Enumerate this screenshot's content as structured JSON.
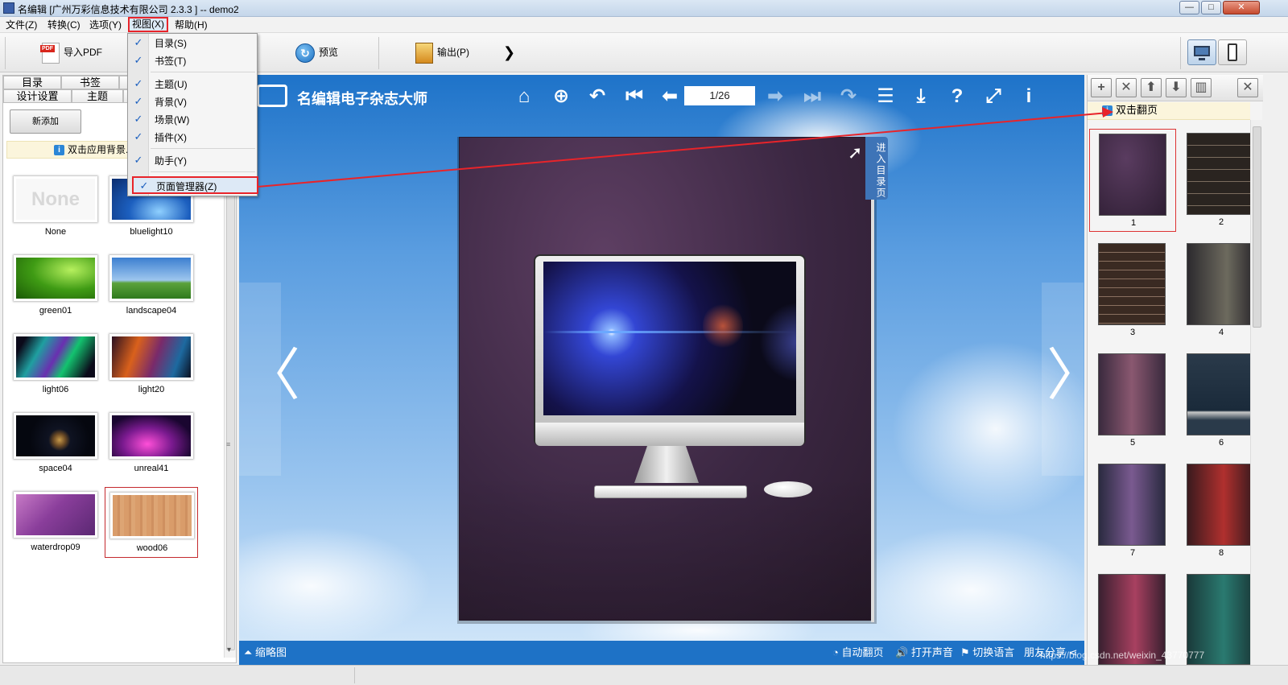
{
  "window": {
    "title": "名编辑 [广州万彩信息技术有限公司 2.3.3 ] -- demo2",
    "controls": {
      "minimize": "—",
      "maximize": "□",
      "close": "✕"
    }
  },
  "menubar": {
    "items": [
      "文件(Z)",
      "转换(C)",
      "选项(Y)",
      "视图(X)",
      "帮助(H)"
    ]
  },
  "toolbar": {
    "import_label": "导入PDF",
    "import_badge": "PDF",
    "preview_label": "预览",
    "preview_glyph": "↻",
    "output_label": "输出(P)",
    "more_glyph": "❯"
  },
  "view_menu": {
    "items": [
      {
        "label": "目录(S)",
        "checked": true
      },
      {
        "label": "书签(T)",
        "checked": true
      },
      {
        "label": "主题(U)",
        "checked": true
      },
      {
        "label": "背景(V)",
        "checked": true
      },
      {
        "label": "场景(W)",
        "checked": true
      },
      {
        "label": "插件(X)",
        "checked": true
      },
      {
        "label": "助手(Y)",
        "checked": true
      },
      {
        "label": "页面管理器(Z)",
        "checked": true
      }
    ],
    "check_glyph": "✓"
  },
  "left_panel": {
    "tabs_row1": [
      "目录",
      "书签",
      ""
    ],
    "tabs_row2": [
      "设计设置",
      "主题",
      ""
    ],
    "add_button": "新添加",
    "hint": "双击应用背景.",
    "info_glyph": "i",
    "backgrounds": [
      {
        "name": "None",
        "preview_text": "None"
      },
      {
        "name": "bluelight10"
      },
      {
        "name": "green01"
      },
      {
        "name": "landscape04"
      },
      {
        "name": "light06"
      },
      {
        "name": "light20"
      },
      {
        "name": "space04"
      },
      {
        "name": "unreal41"
      },
      {
        "name": "waterdrop09"
      },
      {
        "name": "wood06",
        "selected": true
      }
    ],
    "scroll_grip": "≡",
    "scroll_down": "▾"
  },
  "viewer": {
    "logo_text": "名编辑电子杂志大师",
    "icons": [
      {
        "name": "home-icon",
        "glyph": "⌂",
        "enabled": true
      },
      {
        "name": "zoom-in-icon",
        "glyph": "⊕",
        "enabled": true
      },
      {
        "name": "back-icon",
        "glyph": "↶",
        "enabled": true
      },
      {
        "name": "first-page-icon",
        "glyph": "⏮",
        "enabled": true
      },
      {
        "name": "prev-page-icon",
        "glyph": "⬅",
        "enabled": true
      },
      {
        "name": "next-page-icon",
        "glyph": "➡",
        "enabled": false
      },
      {
        "name": "last-page-icon",
        "glyph": "⏭",
        "enabled": false
      },
      {
        "name": "forward-icon",
        "glyph": "↷",
        "enabled": false
      },
      {
        "name": "toc-list-icon",
        "glyph": "☰",
        "enabled": true
      },
      {
        "name": "download-icon",
        "glyph": "⤓",
        "enabled": true
      },
      {
        "name": "help-icon",
        "glyph": "?",
        "enabled": true
      },
      {
        "name": "fullscreen-icon",
        "glyph": "⤢",
        "enabled": true
      },
      {
        "name": "info-icon",
        "glyph": "i",
        "enabled": true
      }
    ],
    "page_indicator": "1/26",
    "toc_tab": "进入目录页",
    "prev_glyph": "〈",
    "next_glyph": "〉",
    "corner_glyph": "➚",
    "bottom": {
      "thumbnail": "缩略图",
      "autoflip": "自动翻页",
      "sound": "打开声音",
      "language": "切换语言",
      "share": "朋友分享"
    },
    "bottom_glyphs": {
      "thumbnail": "⏶",
      "autoflip": "◔",
      "sound": "🔊",
      "language": "⚑",
      "share": "⋖"
    }
  },
  "right_panel": {
    "tool_glyphs": [
      "+",
      "✕",
      "⬆",
      "⬇",
      "▥",
      "✕"
    ],
    "hint": "双击翻页",
    "pages": [
      {
        "label": "1",
        "selected": true
      },
      {
        "label": "2"
      },
      {
        "label": "3"
      },
      {
        "label": "4"
      },
      {
        "label": "5"
      },
      {
        "label": "6"
      },
      {
        "label": "7"
      },
      {
        "label": "8"
      },
      {
        "label": ""
      },
      {
        "label": ""
      }
    ]
  },
  "watermark": "https://blog.csdn.net/weixin_43770777",
  "colors": {
    "accent_red": "#e8242a",
    "bottom_bar": "#1e72c6",
    "check_blue": "#1b5fbf"
  }
}
